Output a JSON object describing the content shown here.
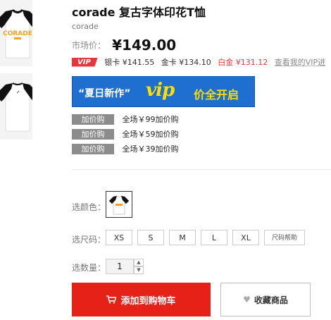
{
  "product": {
    "title": "corade 复古字体印花T恤",
    "brand": "corade",
    "thumb_print": "CORADE"
  },
  "price": {
    "label": "市场价：",
    "value": "¥149.00"
  },
  "vip": {
    "badge": "VIP",
    "silver": "银卡 ¥141.55",
    "gold": "金卡 ¥134.10",
    "platinum": "白金 ¥131.12",
    "link": "查看我的VIP进"
  },
  "banner": {
    "text1": "“夏日新作”",
    "text2": "vip",
    "text3": "价全开启"
  },
  "addons": [
    {
      "tag": "加价购",
      "text": "全场￥99加价购"
    },
    {
      "tag": "加价购",
      "text": "全场￥59加价购"
    },
    {
      "tag": "加价购",
      "text": "全场￥39加价购"
    }
  ],
  "options": {
    "color_label": "选颜色：",
    "size_label": "选尺码：",
    "sizes": [
      "XS",
      "S",
      "M",
      "L",
      "XL"
    ],
    "size_help": "尺码帮助",
    "qty_label": "选数量：",
    "qty_value": "1"
  },
  "actions": {
    "add_to_cart": "添加到购物车",
    "favorite": "收藏商品"
  },
  "colors": {
    "accent_red": "#e62117",
    "vip_red": "#e4393c",
    "banner_blue": "#1f6fd1",
    "banner_yellow": "#ffde00"
  }
}
